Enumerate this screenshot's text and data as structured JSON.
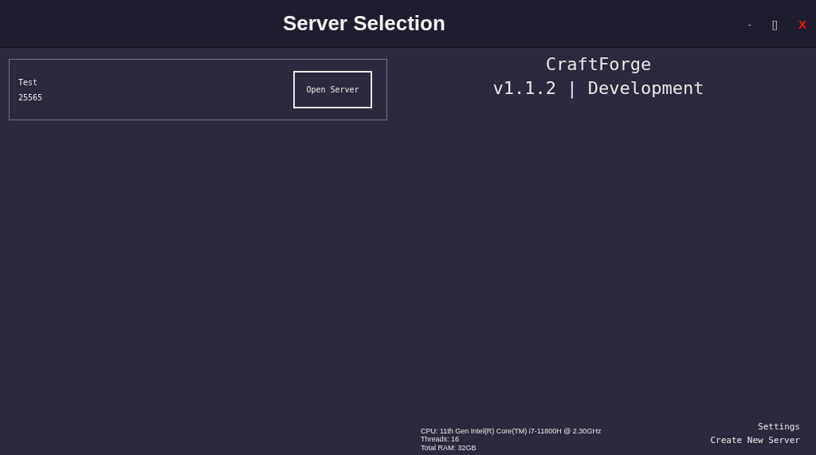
{
  "window": {
    "title": "Server Selection",
    "controls": [
      "-",
      "[]",
      "X"
    ]
  },
  "servers": [
    {
      "name": "Test",
      "port": "25565",
      "action": "Open Server"
    }
  ],
  "app_info": {
    "name": "CraftForge",
    "version": "v1.1.2 | Development"
  },
  "system_info": [
    "CPU: 11th Gen Intel(R) Core(TM) i7-11800H @ 2.30GHz",
    "Threads: 16",
    "Total RAM: 32GB"
  ],
  "links": [
    "Settings",
    "Create New Server"
  ]
}
